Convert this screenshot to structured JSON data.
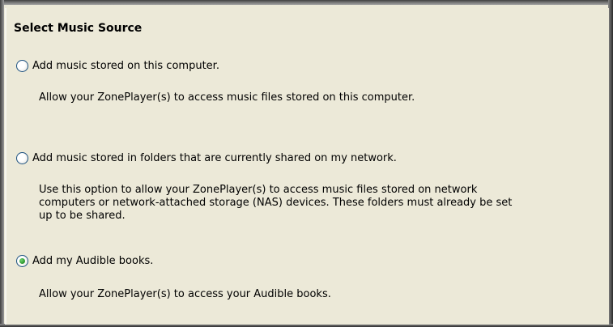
{
  "section": {
    "title": "Select Music Source"
  },
  "options": [
    {
      "label": "Add music stored on this computer.",
      "selected": false,
      "description_lines": [
        "Allow your ZonePlayer(s) to access music files stored on this computer."
      ]
    },
    {
      "label": "Add music stored in folders that are currently shared on my network.",
      "selected": false,
      "description_lines": [
        "Use this option to allow your ZonePlayer(s) to access music files stored on network",
        "computers or network-attached storage (NAS) devices.  These folders must already be set",
        "up to be shared."
      ]
    },
    {
      "label": "Add my Audible books.",
      "selected": true,
      "description_lines": [
        "Allow your ZonePlayer(s) to access your Audible books."
      ]
    }
  ],
  "colors": {
    "panel_background": "#ece9d8",
    "radio_border": "#1c5180",
    "radio_checked_dot": "#21a121"
  }
}
